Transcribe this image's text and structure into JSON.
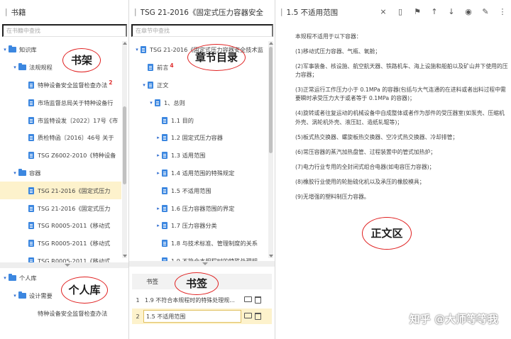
{
  "left": {
    "title": "书籍",
    "search_placeholder": "在书籍中查找",
    "tree": [
      {
        "label": "知识库",
        "level": 0,
        "type": "folder"
      },
      {
        "label": "法规规程",
        "level": 1,
        "type": "folder"
      },
      {
        "label": "特种设备安全监督检查办法",
        "level": 2,
        "type": "doc",
        "badge": "2"
      },
      {
        "label": "市场监督总局关于特种设备行",
        "level": 2,
        "type": "doc"
      },
      {
        "label": "市监特设发〔2022〕17号《市",
        "level": 2,
        "type": "doc"
      },
      {
        "label": "质检特函〔2016〕46号 关于",
        "level": 2,
        "type": "doc"
      },
      {
        "label": "TSG Z6002-2010《特种设备",
        "level": 2,
        "type": "doc"
      },
      {
        "label": "容器",
        "level": 1,
        "type": "folder"
      },
      {
        "label": "TSG 21-2016《固定式压力",
        "level": 2,
        "type": "doc",
        "selected": true
      },
      {
        "label": "TSG 21-2016《固定式压力",
        "level": 2,
        "type": "doc"
      },
      {
        "label": "TSG R0005-2011《移动式",
        "level": 2,
        "type": "doc"
      },
      {
        "label": "TSG R0005-2011《移动式",
        "level": 2,
        "type": "doc"
      },
      {
        "label": "TSG R0005-2011《移动式",
        "level": 2,
        "type": "doc"
      }
    ],
    "personal": [
      {
        "label": "个人库",
        "level": 0,
        "type": "folder"
      },
      {
        "label": "设计需要",
        "level": 1,
        "type": "folder"
      },
      {
        "label": "特种设备安全监督检查办法",
        "level": 2,
        "type": "none"
      }
    ],
    "annot_shelf": "书架",
    "annot_personal": "个人库"
  },
  "mid": {
    "title": "TSG 21-2016《固定式压力容器安全",
    "search_placeholder": "在章节中查找",
    "tree": [
      {
        "label": "TSG 21-2016《固定式压力容器安全技术监",
        "level": 0,
        "caret": "open",
        "type": "doc"
      },
      {
        "label": "前言",
        "level": 1,
        "caret": "",
        "type": "doc",
        "badge": "4"
      },
      {
        "label": "正文",
        "level": 1,
        "caret": "open",
        "type": "doc"
      },
      {
        "label": "1、总则",
        "level": 2,
        "caret": "open",
        "type": "doc"
      },
      {
        "label": "1.1 目的",
        "level": 3,
        "caret": "",
        "type": "doc"
      },
      {
        "label": "1.2 固定式压力容器",
        "level": 3,
        "caret": "closed",
        "type": "doc"
      },
      {
        "label": "1.3 适用范围",
        "level": 3,
        "caret": "closed",
        "type": "doc"
      },
      {
        "label": "1.4 适用范围的特殊规定",
        "level": 3,
        "caret": "closed",
        "type": "doc"
      },
      {
        "label": "1.5 不适用范围",
        "level": 3,
        "caret": "",
        "type": "doc"
      },
      {
        "label": "1.6 压力容器范围的界定",
        "level": 3,
        "caret": "closed",
        "type": "doc"
      },
      {
        "label": "1.7 压力容器分类",
        "level": 3,
        "caret": "closed",
        "type": "doc"
      },
      {
        "label": "1.8 与技术标准、管理制度的关系",
        "level": 3,
        "caret": "",
        "type": "doc"
      },
      {
        "label": "1.9 不符合本规程时的特殊处理规",
        "level": 3,
        "caret": "",
        "type": "doc"
      }
    ],
    "annot_toc": "章节目录",
    "bookmarks": {
      "header": "书签",
      "annot": "书签",
      "rows": [
        {
          "idx": "1",
          "title": "1.9 不符合本规程时的特殊处理规..."
        },
        {
          "idx": "2",
          "title": "1.5 不适用范围",
          "selected": true
        }
      ]
    }
  },
  "right": {
    "title": "1.5 不适用范围",
    "paragraphs": [
      "本规程不适用于以下容器：",
      "(1)移动式压力容器、气瓶、氧舱；",
      "(2)军事装备、核设施、航空航天器、铁路机车、海上设施和船舶以及矿山井下使用的压力容器；",
      "(3)正常运行工作压力小于 0.1MPa 的容器(包括与大气连通的在进料或者出料过程中需要瞬时承受压力大于或者等于 0.1MPa 的容器)；",
      "(4)旋转或者往复运动的机械设备中自成整体或者作为部件的受压器室(如泵壳、压缩机外壳、涡轮机外壳、液压缸、造纸轧辊等)；",
      "(5)板式热交换器、螺旋板热交换器、空冷式热交换器、冷却排管；",
      "(6)常压容器的蒸汽加热盘管、过程装置中的管式加热炉；",
      "(7)电力行业专用的全封闭式组合电器(如电容压力容器)；",
      "(8)橡胶行业使用的轮胎硫化机以及承压的橡胶模具；",
      "(9)无增强的塑料制压力容器。"
    ],
    "annot_content": "正文区",
    "watermark": "知乎 @大师等等我",
    "toolbar": [
      "link-off-icon",
      "pdf-icon",
      "bookmark-icon",
      "arrow-up-icon",
      "arrow-down-icon",
      "eye-icon",
      "edit-icon",
      "more-icon"
    ]
  }
}
